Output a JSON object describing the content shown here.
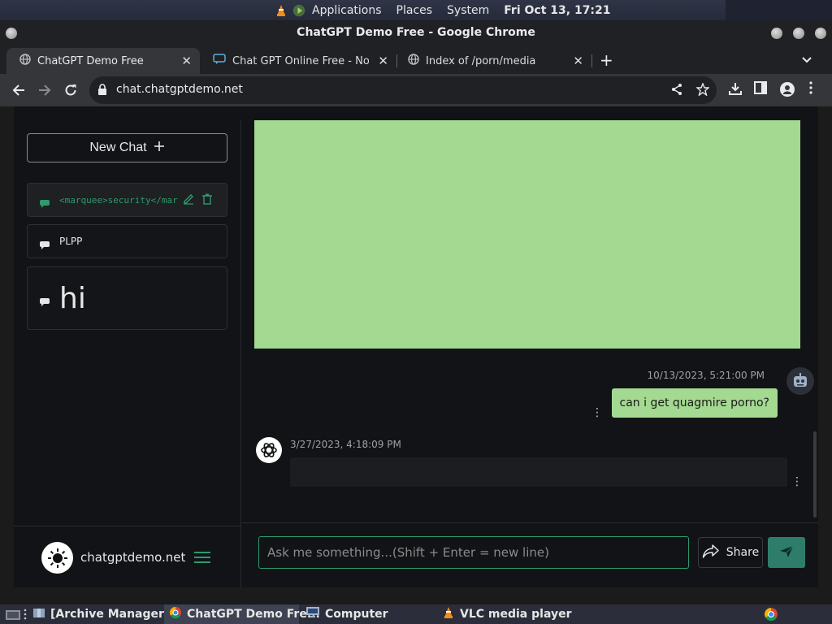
{
  "panel": {
    "applications": "Applications",
    "places": "Places",
    "system": "System",
    "clock": "Fri Oct 13, 17:21"
  },
  "window": {
    "title": "ChatGPT Demo Free - Google Chrome"
  },
  "tabs": [
    {
      "label": "ChatGPT Demo Free",
      "icon": "globe-icon"
    },
    {
      "label": "Chat GPT Online Free - No Lo",
      "icon": "chat-icon"
    },
    {
      "label": "Index of /porn/media",
      "icon": "globe-icon"
    }
  ],
  "toolbar": {
    "url": "chat.chatgptdemo.net"
  },
  "sidebar": {
    "new_chat": "New Chat",
    "chats": [
      {
        "label": "<marquee>security</marquee>"
      },
      {
        "label": "PLPP"
      },
      {
        "label": "hi"
      }
    ],
    "footer_domain": "chatgptdemo.net"
  },
  "conversation": {
    "user_time": "10/13/2023, 5:21:00 PM",
    "user_message": "can i get quagmire porno?",
    "bot_time": "3/27/2023, 4:18:09 PM",
    "bot_message": ""
  },
  "composer": {
    "placeholder": "Ask me something...(Shift + Enter = new line)",
    "share_label": "Share"
  },
  "taskbar": {
    "items": [
      {
        "label": "[Archive Manager]"
      },
      {
        "label": "ChatGPT Demo Fre..."
      },
      {
        "label": "Computer"
      },
      {
        "label": "VLC media player"
      }
    ]
  },
  "colors": {
    "accent_green": "#2e9a6e",
    "bubble_green": "#a3d990",
    "page_bg": "#121316"
  }
}
